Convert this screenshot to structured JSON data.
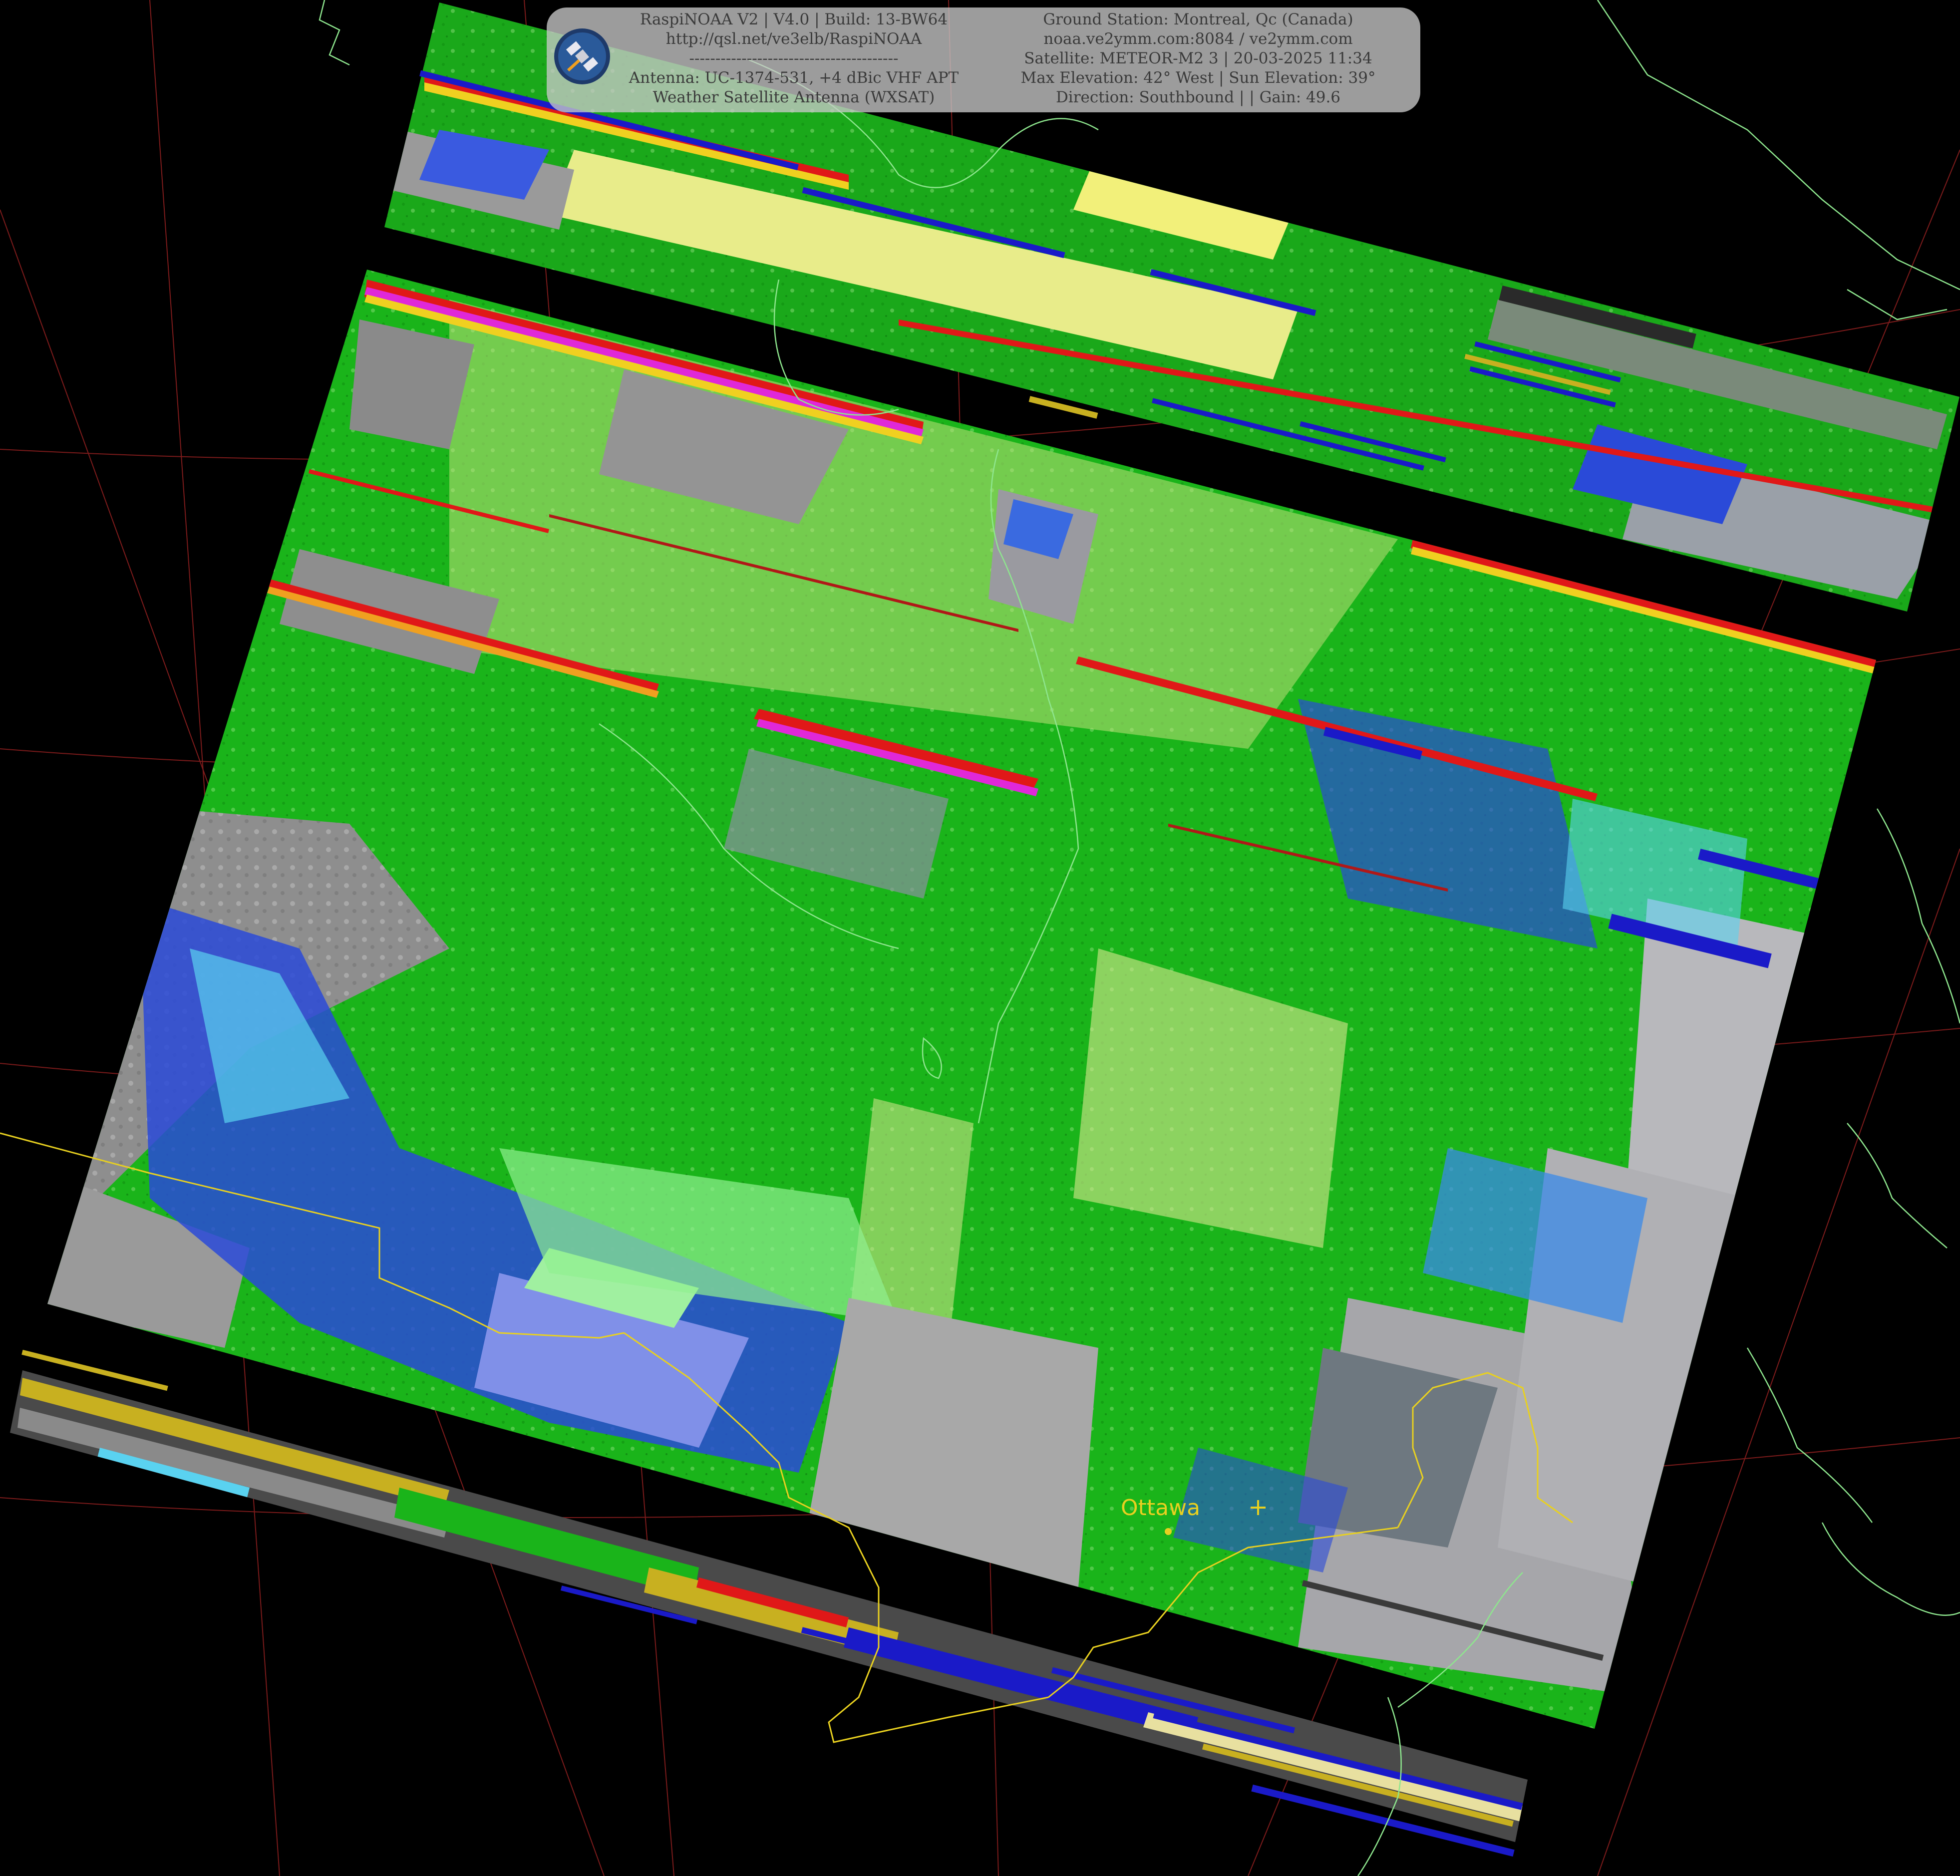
{
  "header": {
    "left_lines": [
      "RaspiNOAA V2 | V4.0 | Build: 13-BW64",
      "http://qsl.net/ve3elb/RaspiNOAA",
      "----------------------------------------",
      "Antenna: UC-1374-531, +4 dBic VHF APT",
      "Weather Satellite Antenna (WXSAT)"
    ],
    "right_lines": [
      "Ground Station: Montreal, Qc (Canada)",
      "noaa.ve2ymm.com:8084 / ve2ymm.com",
      "Satellite: METEOR-M2 3 | 20-03-2025 11:34",
      "Max Elevation: 42° West | Sun Elevation: 39°",
      "Direction: Southbound | | Gain: 49.6"
    ]
  },
  "map": {
    "city": "Ottawa",
    "colors": {
      "background": "#000000",
      "graticule": "#8a1e1e",
      "coastline": "#8ee68e",
      "border": "#e8d020",
      "cloud_green": "#17c417",
      "cloud_yellow": "#e6e68c",
      "cloud_blue": "#2a4ad8",
      "cloud_cyan": "#5ad2f0",
      "cloud_gray": "#9a9a9a",
      "noise_red": "#e01818",
      "noise_magenta": "#e028d8"
    }
  }
}
